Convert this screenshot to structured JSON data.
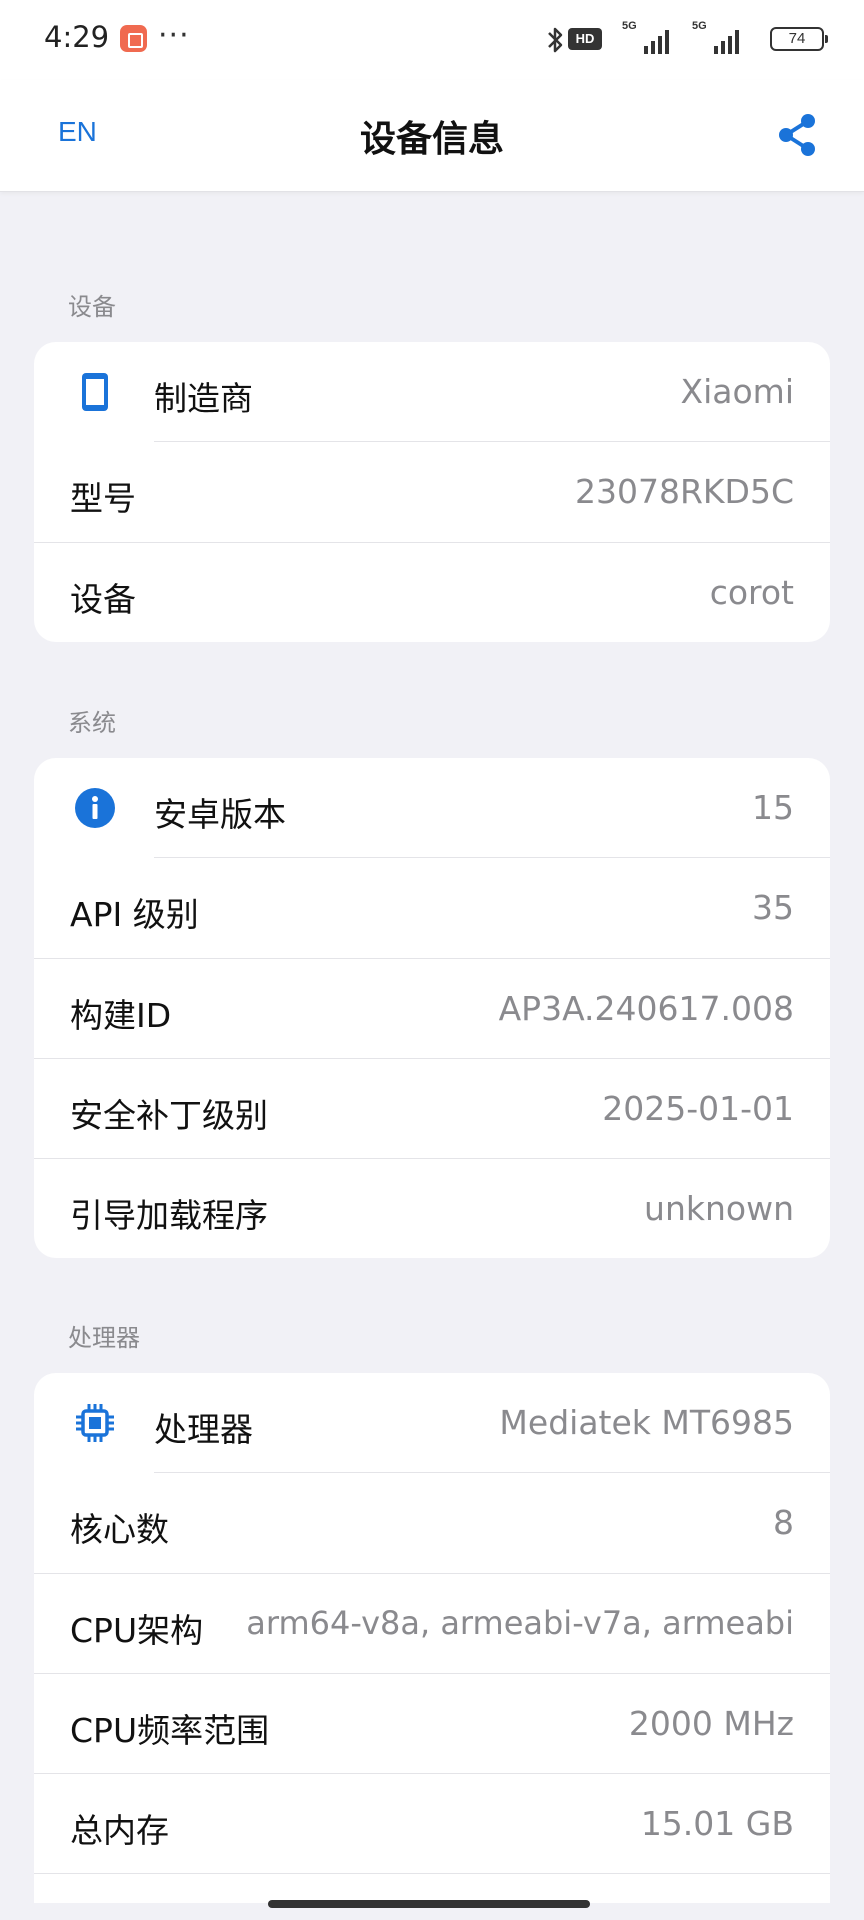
{
  "status_bar": {
    "time": "4:29",
    "more": "···",
    "hd": "HD",
    "network1": "5G",
    "network2": "5G",
    "battery": "74"
  },
  "app_bar": {
    "lang_button": "EN",
    "title": "设备信息",
    "share_icon": "share-icon"
  },
  "sections": {
    "device": {
      "header": "设备",
      "rows": [
        {
          "label": "制造商",
          "value": "Xiaomi",
          "icon": "phone-icon"
        },
        {
          "label": "型号",
          "value": "23078RKD5C"
        },
        {
          "label": "设备",
          "value": "corot"
        }
      ]
    },
    "system": {
      "header": "系统",
      "rows": [
        {
          "label": "安卓版本",
          "value": "15",
          "icon": "info-icon"
        },
        {
          "label": "API 级别",
          "value": "35"
        },
        {
          "label": "构建ID",
          "value": "AP3A.240617.008"
        },
        {
          "label": "安全补丁级别",
          "value": "2025-01-01"
        },
        {
          "label": "引导加载程序",
          "value": "unknown"
        }
      ]
    },
    "processor": {
      "header": "处理器",
      "rows": [
        {
          "label": "处理器",
          "value": "Mediatek MT6985",
          "icon": "chip-icon"
        },
        {
          "label": "核心数",
          "value": "8"
        },
        {
          "label": "CPU架构",
          "value": "arm64-v8a, armeabi-v7a, armeabi"
        },
        {
          "label": "CPU频率范围",
          "value": "2000 MHz"
        },
        {
          "label": "总内存",
          "value": "15.01 GB"
        }
      ]
    }
  },
  "colors": {
    "accent": "#1a73d9",
    "background": "#f1f1f6",
    "card": "#ffffff",
    "value_text": "#8a8a8e"
  }
}
